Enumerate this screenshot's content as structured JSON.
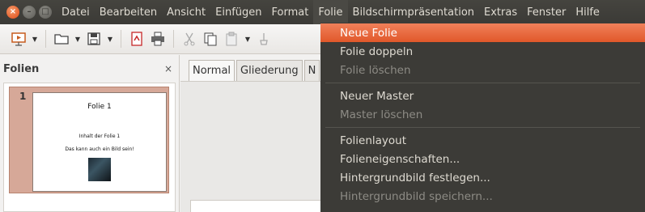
{
  "menubar": {
    "items": [
      "Datei",
      "Bearbeiten",
      "Ansicht",
      "Einfügen",
      "Format",
      "Folie",
      "Bildschirmpräsentation",
      "Extras",
      "Fenster",
      "Hilfe"
    ]
  },
  "slides_pane": {
    "title": "Folien",
    "close": "×",
    "slide_number": "1",
    "thumb_title": "Folie 1",
    "thumb_line1": "Inhalt der Folie 1",
    "thumb_line2": "Das kann auch ein Bild sein!"
  },
  "editor": {
    "tabs": [
      "Normal",
      "Gliederung",
      "N"
    ]
  },
  "folie_menu": {
    "items": [
      {
        "label": "Neue Folie",
        "state": "highlighted"
      },
      {
        "label": "Folie doppeln",
        "state": "enabled"
      },
      {
        "label": "Folie löschen",
        "state": "disabled"
      },
      {
        "label": "Neuer Master",
        "state": "enabled"
      },
      {
        "label": "Master löschen",
        "state": "disabled"
      },
      {
        "label": "Folienlayout",
        "state": "enabled"
      },
      {
        "label": "Folieneigenschaften...",
        "state": "enabled"
      },
      {
        "label": "Hintergrundbild festlegen...",
        "state": "enabled"
      },
      {
        "label": "Hintergrundbild speichern...",
        "state": "disabled"
      }
    ]
  },
  "colors": {
    "menubar_bg": "#3c3b37",
    "highlight": "#e9622f",
    "slide_selection": "#d6a898"
  }
}
